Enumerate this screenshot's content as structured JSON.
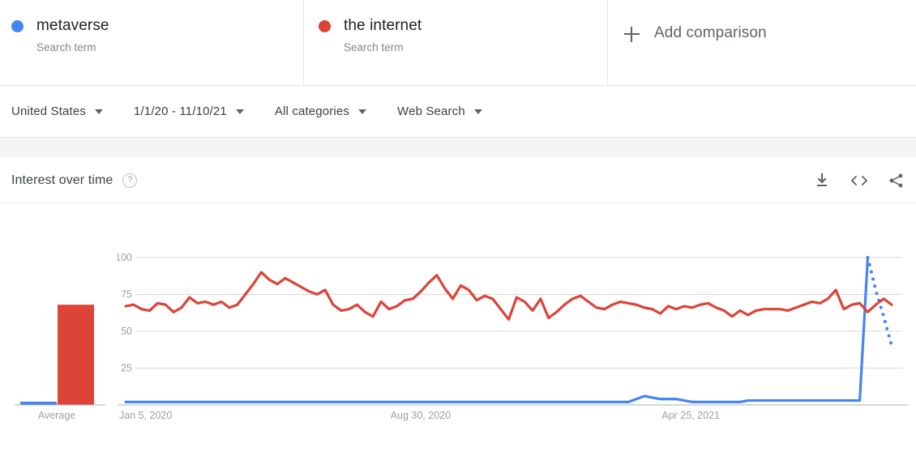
{
  "terms": [
    {
      "name": "metaverse",
      "subtitle": "Search term",
      "color": "#4285f4",
      "dot": "legend-dot-blue"
    },
    {
      "name": "the internet",
      "subtitle": "Search term",
      "color": "#db4437",
      "dot": "legend-dot-red"
    }
  ],
  "add_comparison": {
    "label": "Add comparison",
    "icon": "plus-icon"
  },
  "filters": [
    {
      "label": "United States",
      "name": "location-filter"
    },
    {
      "label": "1/1/20 - 11/10/21",
      "name": "date-range-filter"
    },
    {
      "label": "All categories",
      "name": "category-filter"
    },
    {
      "label": "Web Search",
      "name": "search-type-filter"
    }
  ],
  "card": {
    "title": "Interest over time",
    "help_icon": "?",
    "actions": [
      {
        "name": "download-csv-icon"
      },
      {
        "name": "embed-code-icon"
      },
      {
        "name": "share-icon"
      }
    ]
  },
  "chart_data": {
    "type": "line",
    "title": "Interest over time",
    "xlabel": "",
    "ylabel": "",
    "ylim": [
      0,
      100
    ],
    "yticks": [
      0,
      25,
      50,
      75,
      100
    ],
    "ytick_labels": [
      "",
      "25",
      "50",
      "75",
      "100"
    ],
    "grid": true,
    "legend_position": "top",
    "xtick_labels": [
      "Jan 5, 2020",
      "Aug 30, 2020",
      "Apr 25, 2021"
    ],
    "xtick_indices": [
      0,
      34,
      68
    ],
    "n_points": 97,
    "series": [
      {
        "name": "metaverse",
        "color": "#4285f4",
        "partial_tail": true,
        "values": [
          2,
          2,
          2,
          2,
          2,
          2,
          2,
          2,
          2,
          2,
          2,
          2,
          2,
          2,
          2,
          2,
          2,
          2,
          2,
          2,
          2,
          2,
          2,
          2,
          2,
          2,
          2,
          2,
          2,
          2,
          2,
          2,
          2,
          2,
          2,
          2,
          2,
          2,
          2,
          2,
          2,
          2,
          2,
          2,
          2,
          2,
          2,
          2,
          2,
          2,
          2,
          2,
          2,
          2,
          2,
          2,
          2,
          2,
          2,
          2,
          2,
          2,
          2,
          2,
          4,
          6,
          5,
          4,
          4,
          4,
          3,
          2,
          2,
          2,
          2,
          2,
          2,
          2,
          3,
          3,
          3,
          3,
          3,
          3,
          3,
          3,
          3,
          3,
          3,
          3,
          3,
          3,
          3,
          100,
          78,
          60,
          40
        ]
      },
      {
        "name": "the internet",
        "color": "#db4437",
        "partial_tail": false,
        "values": [
          67,
          68,
          65,
          64,
          69,
          68,
          63,
          66,
          73,
          69,
          70,
          68,
          70,
          66,
          68,
          75,
          82,
          90,
          85,
          82,
          86,
          83,
          80,
          77,
          75,
          78,
          68,
          64,
          65,
          68,
          63,
          60,
          70,
          65,
          67,
          71,
          72,
          77,
          83,
          88,
          79,
          72,
          81,
          78,
          71,
          74,
          72,
          65,
          58,
          73,
          70,
          64,
          72,
          59,
          63,
          68,
          72,
          74,
          70,
          66,
          65,
          68,
          70,
          69,
          68,
          66,
          65,
          62,
          67,
          65,
          67,
          66,
          68,
          69,
          66,
          64,
          60,
          64,
          61,
          64,
          65,
          65,
          65,
          64,
          66,
          68,
          70,
          69,
          72,
          78,
          65,
          68,
          69,
          63,
          68,
          72,
          68
        ]
      }
    ],
    "average_bars": {
      "label": "Average",
      "values": [
        2,
        68
      ],
      "colors": [
        "#4285f4",
        "#db4437"
      ],
      "names": [
        "metaverse",
        "the internet"
      ]
    }
  }
}
